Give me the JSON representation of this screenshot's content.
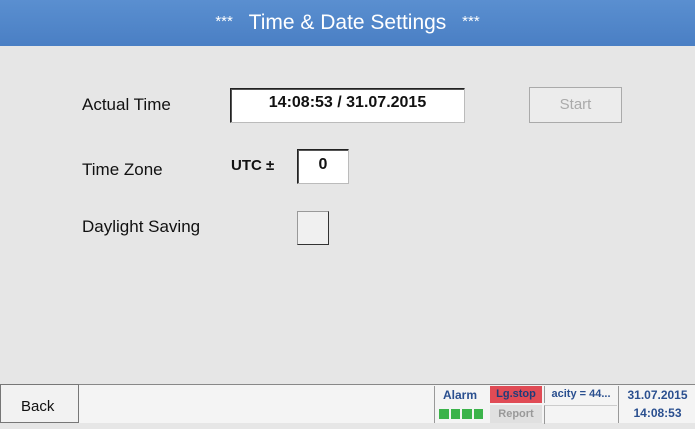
{
  "header": {
    "stars_left": "***",
    "title": "Time & Date Settings",
    "stars_right": "***"
  },
  "settings": {
    "actual_time_label": "Actual Time",
    "actual_time_value": "14:08:53 / 31.07.2015",
    "start_label": "Start",
    "time_zone_label": "Time Zone",
    "utc_label": "UTC ±",
    "time_zone_value": "0",
    "daylight_saving_label": "Daylight Saving",
    "daylight_saving_checked": false
  },
  "footer": {
    "back_label": "Back",
    "alarm_label": "Alarm",
    "lgstop_label": "Lg.stop",
    "report_label": "Report",
    "capacity_label": "acity = 44...",
    "date": "31.07.2015",
    "time": "14:08:53"
  },
  "colors": {
    "header": "#4a7fc4",
    "alarm_ok": "#3bb34a",
    "lgstop": "#e04b55",
    "status_text": "#2a4f8f"
  }
}
